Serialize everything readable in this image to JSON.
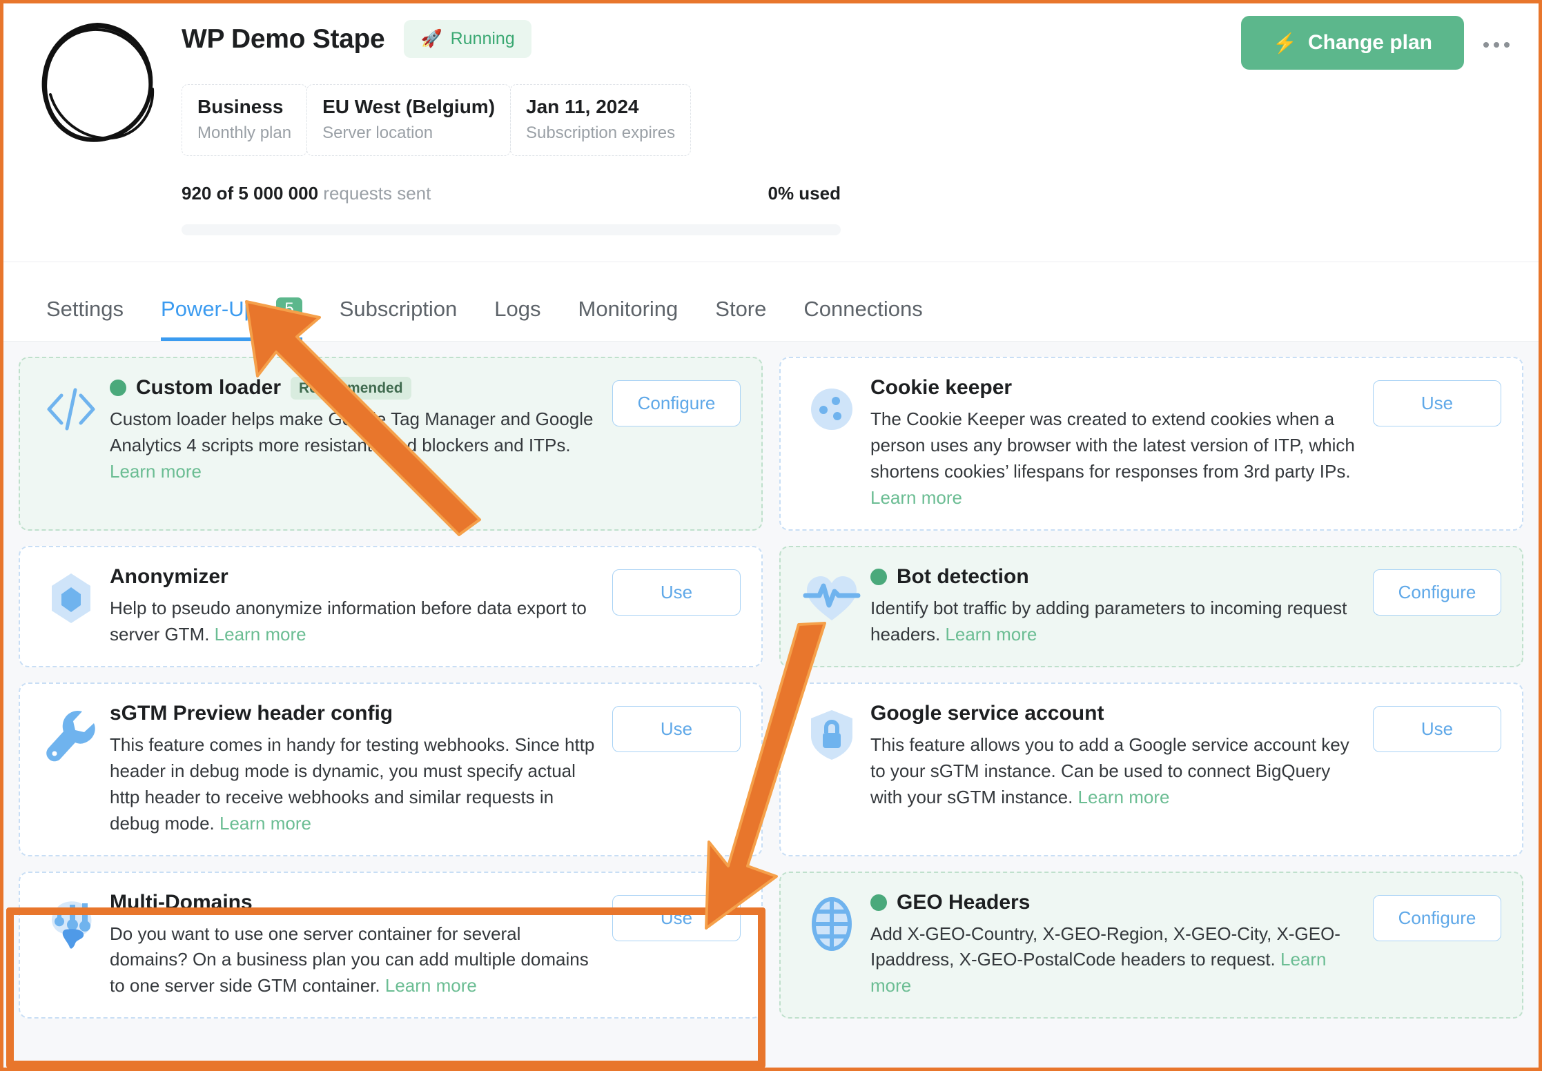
{
  "header": {
    "logo_alt": "hand-drawn-circle-logo",
    "title": "WP Demo Stape",
    "status": {
      "icon": "🚀",
      "label": "Running"
    },
    "meta": [
      {
        "value": "Business",
        "label": "Monthly plan"
      },
      {
        "value": "EU West (Belgium)",
        "label": "Server location"
      },
      {
        "value": "Jan 11, 2024",
        "label": "Subscription expires"
      }
    ],
    "usage": {
      "sent_count": "920 of 5 000 000",
      "sent_suffix": "requests sent",
      "percent_used": "0% used",
      "progress_percent": 0
    },
    "change_plan": {
      "icon": "⚡",
      "label": "Change plan"
    },
    "more_menu": "more-options"
  },
  "tabs": [
    {
      "label": "Settings",
      "active": false,
      "badge": null
    },
    {
      "label": "Power-Ups",
      "active": true,
      "badge": "5"
    },
    {
      "label": "Subscription",
      "active": false,
      "badge": null
    },
    {
      "label": "Logs",
      "active": false,
      "badge": null
    },
    {
      "label": "Monitoring",
      "active": false,
      "badge": null
    },
    {
      "label": "Store",
      "active": false,
      "badge": null
    },
    {
      "label": "Connections",
      "active": false,
      "badge": null
    }
  ],
  "powerups": [
    {
      "id": "custom-loader",
      "icon": "code-brackets-icon",
      "title": "Custom loader",
      "enabled": true,
      "badge": "Recommended",
      "desc": "Custom loader helps make Google Tag Manager and Google Analytics 4 scripts more resistant to ad blockers and ITPs. ",
      "learn_more": "Learn more",
      "action": "Configure"
    },
    {
      "id": "cookie-keeper",
      "icon": "cookie-icon",
      "title": "Cookie keeper",
      "enabled": false,
      "badge": null,
      "desc": "The Cookie Keeper was created to extend cookies when a person uses any browser with the latest version of ITP, which shortens cookies’ lifespans for responses from 3rd party IPs. ",
      "learn_more": "Learn more",
      "action": "Use"
    },
    {
      "id": "anonymizer",
      "icon": "hexagon-shield-icon",
      "title": "Anonymizer",
      "enabled": false,
      "badge": null,
      "desc": "Help to pseudo anonymize information before data export to server GTM. ",
      "learn_more": "Learn more",
      "action": "Use"
    },
    {
      "id": "bot-detection",
      "icon": "heart-pulse-icon",
      "title": "Bot detection",
      "enabled": true,
      "badge": null,
      "desc": "Identify bot traffic by adding parameters to incoming request headers. ",
      "learn_more": "Learn more",
      "action": "Configure"
    },
    {
      "id": "sgtm-preview-header-config",
      "icon": "wrench-icon",
      "title": "sGTM Preview header config",
      "enabled": false,
      "badge": null,
      "desc": "This feature comes in handy for testing webhooks. Since http header in debug mode is dynamic, you must specify actual http header to receive webhooks and similar requests in debug mode. ",
      "learn_more": "Learn more",
      "action": "Use"
    },
    {
      "id": "google-service-account",
      "icon": "shield-lock-icon",
      "title": "Google service account",
      "enabled": false,
      "badge": null,
      "desc": "This feature allows you to add a Google service account key to your sGTM instance. Can be used to connect BigQuery with your sGTM instance. ",
      "learn_more": "Learn more",
      "action": "Use"
    },
    {
      "id": "multi-domains",
      "icon": "multi-domains-brain-icon",
      "title": "Multi-Domains",
      "enabled": false,
      "badge": null,
      "desc": "Do you want to use one server container for several domains? On a business plan you can add multiple domains to one server side GTM container. ",
      "learn_more": "Learn more",
      "action": "Use",
      "highlighted": true
    },
    {
      "id": "geo-headers",
      "icon": "globe-grid-icon",
      "title": "GEO Headers",
      "enabled": true,
      "badge": null,
      "desc": "Add X-GEO-Country, X-GEO-Region, X-GEO-City, X-GEO-Ipaddress, X-GEO-PostalCode headers to request. ",
      "learn_more": "Learn more",
      "action": "Configure"
    }
  ],
  "annotations": {
    "highlight_color": "#e8762c",
    "arrow_color": "#e8762c",
    "arrow_count": 2
  },
  "colors": {
    "accent_green": "#5cb78c",
    "accent_blue": "#3b9bf0",
    "enabled_card_bg": "#eff7f3",
    "page_bg": "#f7f8fa",
    "annotation_orange": "#e8762c"
  }
}
